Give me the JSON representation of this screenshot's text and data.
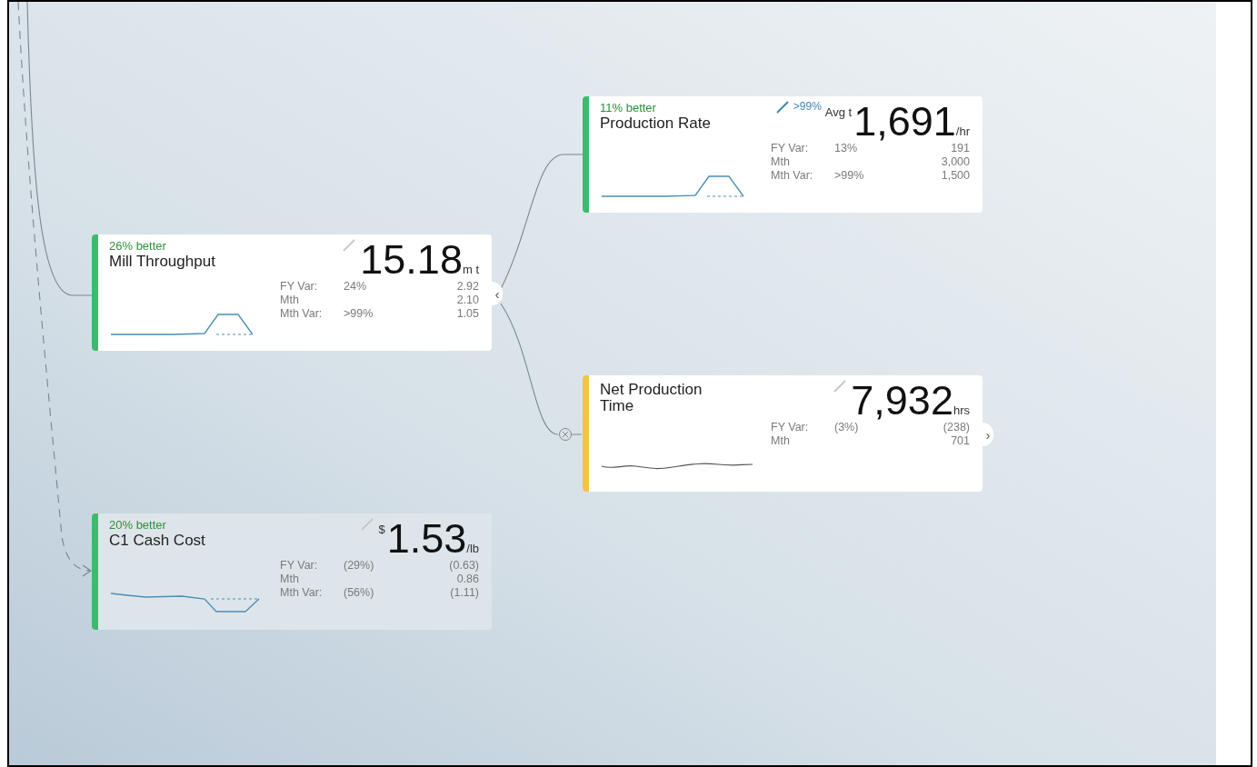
{
  "cards": [
    {
      "status": "11% better",
      "title": "Production Rate",
      "badge": ">99%",
      "prefix": "Avg t",
      "value": "1,691",
      "unit": "/hr",
      "color": "#3dba6e",
      "dimmed": false,
      "rows": [
        {
          "label": "FY Var:",
          "pct": "13%",
          "value": "191"
        },
        {
          "label": "Mth",
          "value": "3,000"
        },
        {
          "label": "Mth Var:",
          "pct": ">99%",
          "value": "1,500"
        }
      ]
    },
    {
      "status": "26% better",
      "title": "Mill Throughput",
      "value": "15.18",
      "unit": "m t",
      "color": "#3dba6e",
      "dimmed": false,
      "toggle": "‹",
      "rows": [
        {
          "label": "FY Var:",
          "pct": "24%",
          "value": "2.92"
        },
        {
          "label": "Mth",
          "value": "2.10"
        },
        {
          "label": "Mth Var:",
          "pct": ">99%",
          "value": "1.05"
        }
      ]
    },
    {
      "title": "Net Production Time",
      "value": "7,932",
      "unit": "hrs",
      "color": "#f5c342",
      "dimmed": false,
      "toggle": "›",
      "rows": [
        {
          "label": "FY Var:",
          "pct": "(3%)",
          "value": "(238)"
        },
        {
          "label": "Mth",
          "value": "701"
        }
      ]
    },
    {
      "status": "20% better",
      "title": "C1 Cash Cost",
      "prefix": "$",
      "value": "1.53",
      "unit": "/lb",
      "color": "#3dba6e",
      "dimmed": true,
      "rows": [
        {
          "label": "FY Var:",
          "pct": "(29%)",
          "value": "(0.63)"
        },
        {
          "label": "Mth",
          "value": "0.86"
        },
        {
          "label": "Mth Var:",
          "pct": "(56%)",
          "value": "(1.11)"
        }
      ]
    }
  ]
}
